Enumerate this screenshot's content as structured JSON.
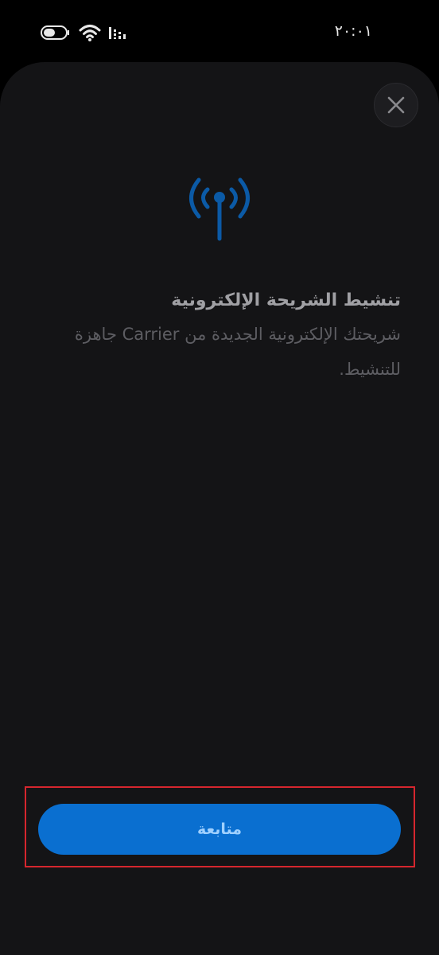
{
  "status_bar": {
    "time": "٢٠:٠١",
    "icons": [
      "battery-icon",
      "wifi-icon",
      "signal-icon"
    ]
  },
  "dialog": {
    "close_icon": "close-icon",
    "hero_icon": "cellular-antenna-icon",
    "title": "تنشيط الشريحة الإلكترونية",
    "description": "شريحتك الإلكترونية الجديدة من Carrier جاهزة للتنشيط.",
    "continue_label": "متابعة"
  },
  "colors": {
    "background": "#000000",
    "sheet": "#141416",
    "accent": "#0a6fd0",
    "button_text": "#9fd0ff",
    "highlight": "#d6262e"
  }
}
